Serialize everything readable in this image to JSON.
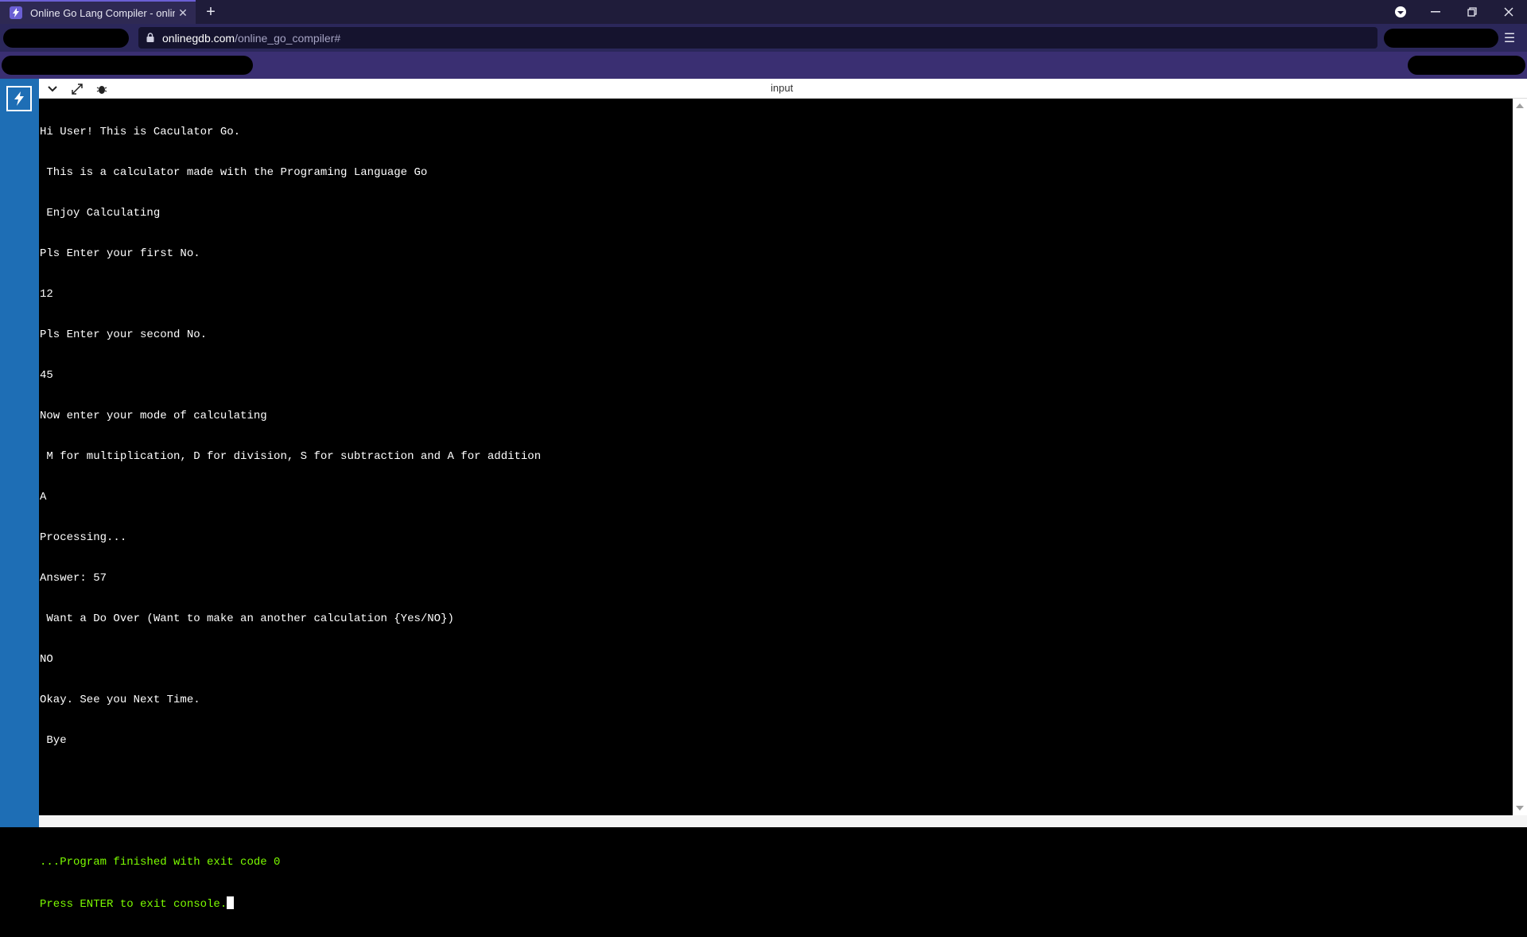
{
  "browser": {
    "tab_title": "Online Go Lang Compiler - online",
    "url_host": "onlinegdb.com",
    "url_path": "/online_go_compiler#"
  },
  "panel": {
    "header_label": "input"
  },
  "console": {
    "lines": [
      "Hi User! This is Caculator Go.",
      " This is a calculator made with the Programing Language Go",
      " Enjoy Calculating",
      "Pls Enter your first No.",
      "12",
      "Pls Enter your second No.",
      "45",
      "Now enter your mode of calculating",
      " M for multiplication, D for division, S for subtraction and A for addition",
      "A",
      "Processing...",
      "Answer: 57",
      " Want a Do Over (Want to make an another calculation {Yes/NO})",
      "NO",
      "Okay. See you Next Time.",
      " Bye",
      "",
      ""
    ],
    "finish_line": "...Program finished with exit code 0",
    "press_enter_line": "Press ENTER to exit console."
  },
  "colors": {
    "accent": "#6b5fd4",
    "sidebar_blue": "#1e6eb5",
    "console_green": "#7cfc00"
  },
  "icons": {
    "tab_favicon": "bolt-icon",
    "new_tab": "plus-icon",
    "lock": "lock-icon",
    "sidebar_logo": "bolt-icon",
    "collapse": "chevron-down-icon",
    "expand": "expand-icon",
    "debug": "bug-icon"
  }
}
